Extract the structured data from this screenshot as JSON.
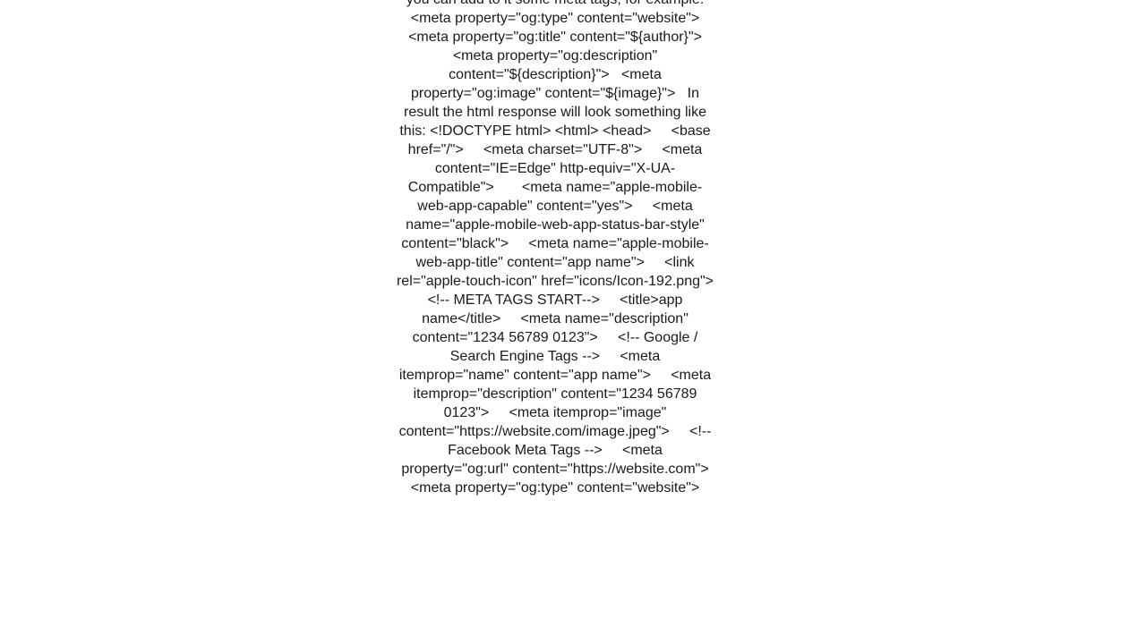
{
  "page": {
    "background_color": "#ffffff",
    "text_color": "#1a1a1a",
    "body_text": "you can add to it some meta tags, for example:   <meta property=\"og:type\" content=\"website\">   <meta property=\"og:title\" content=\"${author}\">   <meta property=\"og:description\" content=\"${description}\">   <meta property=\"og:image\" content=\"${image}\">   In result the html response will look something like this: <!DOCTYPE html> <html> <head>     <base href=\"/\">     <meta charset=\"UTF-8\">     <meta content=\"IE=Edge\" http-equiv=\"X-UA-Compatible\">       <meta name=\"apple-mobile-web-app-capable\" content=\"yes\">     <meta name=\"apple-mobile-web-app-status-bar-style\" content=\"black\">     <meta name=\"apple-mobile-web-app-title\" content=\"app name\">     <link rel=\"apple-touch-icon\" href=\"icons/Icon-192.png\">     <!-- META TAGS START-->     <title>app name</title>     <meta name=\"description\" content=\"1234 56789 0123\">     <!-- Google / Search Engine Tags -->     <meta itemprop=\"name\" content=\"app name\">     <meta itemprop=\"description\" content=\"1234 56789 0123\">     <meta itemprop=\"image\"      content=\"https://website.com/image.jpeg\">     <!-- Facebook Meta Tags -->     <meta property=\"og:url\" content=\"https://website.com\">     <meta property=\"og:type\" content=\"website\">"
  }
}
